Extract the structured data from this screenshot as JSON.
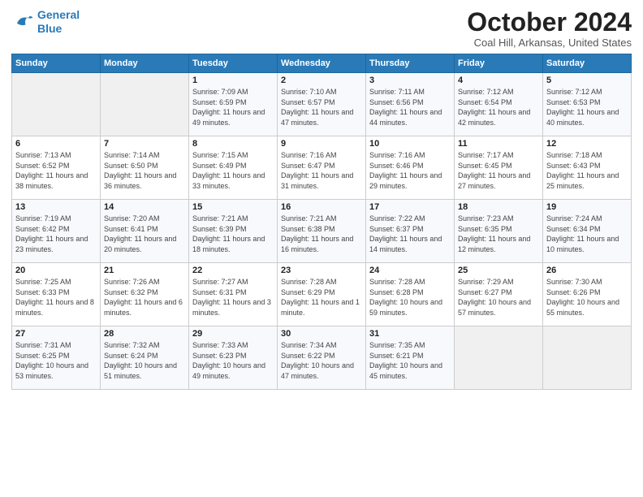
{
  "header": {
    "logo_line1": "General",
    "logo_line2": "Blue",
    "month": "October 2024",
    "location": "Coal Hill, Arkansas, United States"
  },
  "days_of_week": [
    "Sunday",
    "Monday",
    "Tuesday",
    "Wednesday",
    "Thursday",
    "Friday",
    "Saturday"
  ],
  "weeks": [
    [
      {
        "day": "",
        "info": ""
      },
      {
        "day": "",
        "info": ""
      },
      {
        "day": "1",
        "info": "Sunrise: 7:09 AM\nSunset: 6:59 PM\nDaylight: 11 hours and 49 minutes."
      },
      {
        "day": "2",
        "info": "Sunrise: 7:10 AM\nSunset: 6:57 PM\nDaylight: 11 hours and 47 minutes."
      },
      {
        "day": "3",
        "info": "Sunrise: 7:11 AM\nSunset: 6:56 PM\nDaylight: 11 hours and 44 minutes."
      },
      {
        "day": "4",
        "info": "Sunrise: 7:12 AM\nSunset: 6:54 PM\nDaylight: 11 hours and 42 minutes."
      },
      {
        "day": "5",
        "info": "Sunrise: 7:12 AM\nSunset: 6:53 PM\nDaylight: 11 hours and 40 minutes."
      }
    ],
    [
      {
        "day": "6",
        "info": "Sunrise: 7:13 AM\nSunset: 6:52 PM\nDaylight: 11 hours and 38 minutes."
      },
      {
        "day": "7",
        "info": "Sunrise: 7:14 AM\nSunset: 6:50 PM\nDaylight: 11 hours and 36 minutes."
      },
      {
        "day": "8",
        "info": "Sunrise: 7:15 AM\nSunset: 6:49 PM\nDaylight: 11 hours and 33 minutes."
      },
      {
        "day": "9",
        "info": "Sunrise: 7:16 AM\nSunset: 6:47 PM\nDaylight: 11 hours and 31 minutes."
      },
      {
        "day": "10",
        "info": "Sunrise: 7:16 AM\nSunset: 6:46 PM\nDaylight: 11 hours and 29 minutes."
      },
      {
        "day": "11",
        "info": "Sunrise: 7:17 AM\nSunset: 6:45 PM\nDaylight: 11 hours and 27 minutes."
      },
      {
        "day": "12",
        "info": "Sunrise: 7:18 AM\nSunset: 6:43 PM\nDaylight: 11 hours and 25 minutes."
      }
    ],
    [
      {
        "day": "13",
        "info": "Sunrise: 7:19 AM\nSunset: 6:42 PM\nDaylight: 11 hours and 23 minutes."
      },
      {
        "day": "14",
        "info": "Sunrise: 7:20 AM\nSunset: 6:41 PM\nDaylight: 11 hours and 20 minutes."
      },
      {
        "day": "15",
        "info": "Sunrise: 7:21 AM\nSunset: 6:39 PM\nDaylight: 11 hours and 18 minutes."
      },
      {
        "day": "16",
        "info": "Sunrise: 7:21 AM\nSunset: 6:38 PM\nDaylight: 11 hours and 16 minutes."
      },
      {
        "day": "17",
        "info": "Sunrise: 7:22 AM\nSunset: 6:37 PM\nDaylight: 11 hours and 14 minutes."
      },
      {
        "day": "18",
        "info": "Sunrise: 7:23 AM\nSunset: 6:35 PM\nDaylight: 11 hours and 12 minutes."
      },
      {
        "day": "19",
        "info": "Sunrise: 7:24 AM\nSunset: 6:34 PM\nDaylight: 11 hours and 10 minutes."
      }
    ],
    [
      {
        "day": "20",
        "info": "Sunrise: 7:25 AM\nSunset: 6:33 PM\nDaylight: 11 hours and 8 minutes."
      },
      {
        "day": "21",
        "info": "Sunrise: 7:26 AM\nSunset: 6:32 PM\nDaylight: 11 hours and 6 minutes."
      },
      {
        "day": "22",
        "info": "Sunrise: 7:27 AM\nSunset: 6:31 PM\nDaylight: 11 hours and 3 minutes."
      },
      {
        "day": "23",
        "info": "Sunrise: 7:28 AM\nSunset: 6:29 PM\nDaylight: 11 hours and 1 minute."
      },
      {
        "day": "24",
        "info": "Sunrise: 7:28 AM\nSunset: 6:28 PM\nDaylight: 10 hours and 59 minutes."
      },
      {
        "day": "25",
        "info": "Sunrise: 7:29 AM\nSunset: 6:27 PM\nDaylight: 10 hours and 57 minutes."
      },
      {
        "day": "26",
        "info": "Sunrise: 7:30 AM\nSunset: 6:26 PM\nDaylight: 10 hours and 55 minutes."
      }
    ],
    [
      {
        "day": "27",
        "info": "Sunrise: 7:31 AM\nSunset: 6:25 PM\nDaylight: 10 hours and 53 minutes."
      },
      {
        "day": "28",
        "info": "Sunrise: 7:32 AM\nSunset: 6:24 PM\nDaylight: 10 hours and 51 minutes."
      },
      {
        "day": "29",
        "info": "Sunrise: 7:33 AM\nSunset: 6:23 PM\nDaylight: 10 hours and 49 minutes."
      },
      {
        "day": "30",
        "info": "Sunrise: 7:34 AM\nSunset: 6:22 PM\nDaylight: 10 hours and 47 minutes."
      },
      {
        "day": "31",
        "info": "Sunrise: 7:35 AM\nSunset: 6:21 PM\nDaylight: 10 hours and 45 minutes."
      },
      {
        "day": "",
        "info": ""
      },
      {
        "day": "",
        "info": ""
      }
    ]
  ]
}
